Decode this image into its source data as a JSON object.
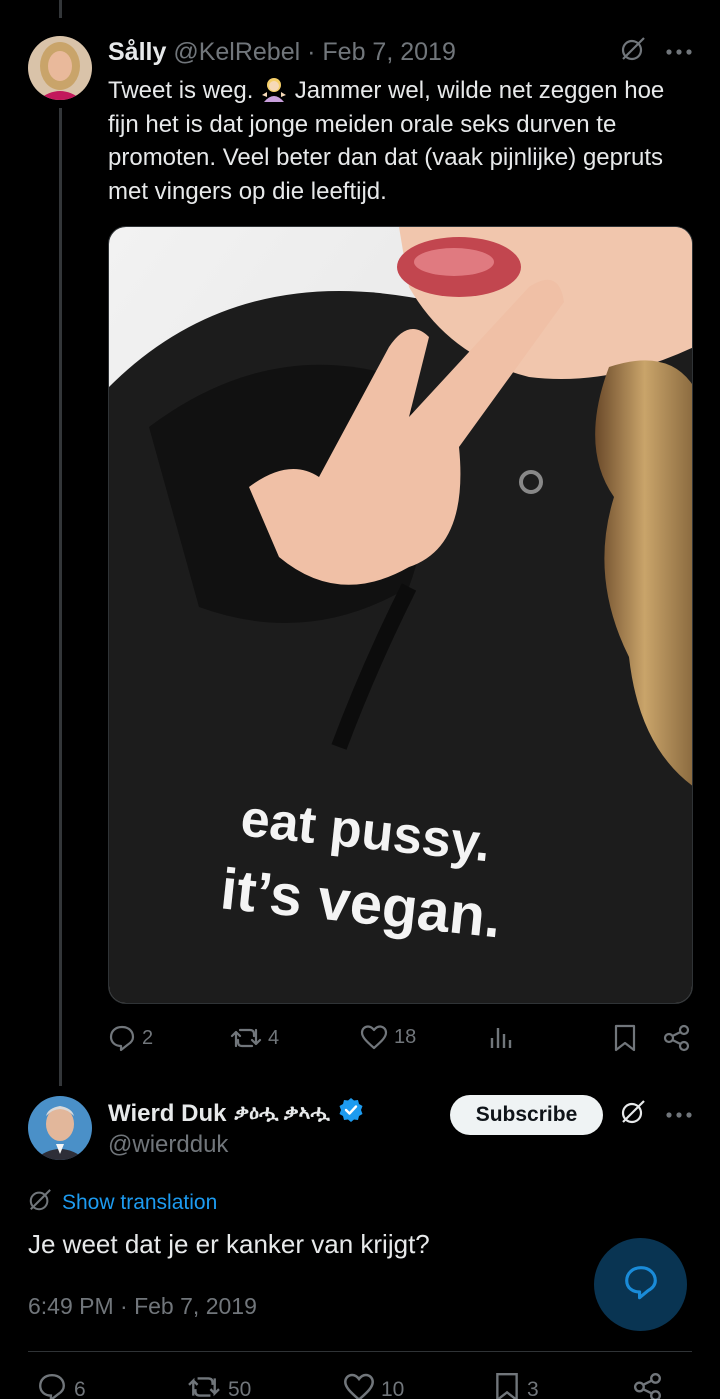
{
  "tweet1": {
    "name": "Sålly",
    "handle": "@KelRebel",
    "separator": "·",
    "date": "Feb 7, 2019",
    "text_before_emoji": "Tweet is weg. ",
    "emoji": "woman-shrugging-emoji",
    "text_after_emoji": " Jammer wel, wilde net zeggen hoe fijn het is dat jonge meiden orale seks durven te promoten. Veel beter dan dat (vaak pijnlijke) gepruts met vingers op die leeftijd.",
    "image": {
      "shirt_line1": "eat pussy.",
      "shirt_line2": "it’s vegan."
    },
    "stats": {
      "replies": "2",
      "reposts": "4",
      "likes": "18"
    }
  },
  "tweet2": {
    "name": "Wierd Duk",
    "name_script": "ቃዕሗ ቃኣሗ",
    "verified": true,
    "handle": "@wierdduk",
    "subscribe_label": "Subscribe",
    "translation_label": "Show translation",
    "text": "Je weet dat je er kanker van krijgt?",
    "timestamp": "6:49 PM · Feb 7, 2019",
    "stats": {
      "replies": "6",
      "reposts": "50",
      "likes": "10",
      "bookmarks": "3"
    }
  },
  "colors": {
    "background": "#000000",
    "text": "#e7e9ea",
    "muted": "#71767b",
    "accent": "#1d9bf0",
    "fab": "#0b3a5b"
  },
  "icons": [
    "grok-icon",
    "more-icon",
    "reply-icon",
    "repost-icon",
    "like-icon",
    "views-icon",
    "bookmark-icon",
    "share-icon",
    "verified-badge-icon",
    "translate-icon",
    "compose-reply-icon"
  ]
}
